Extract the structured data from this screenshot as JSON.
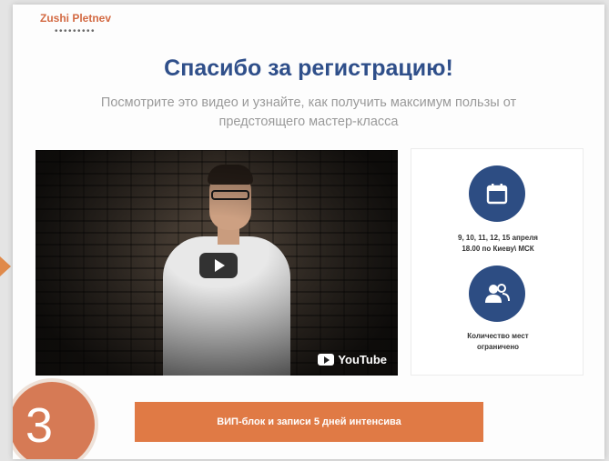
{
  "header": {
    "logo_text": "Zushi Pletnev",
    "logo_dots": "•••••••••"
  },
  "hero": {
    "title": "Спасибо за регистрацию!",
    "subtitle_line1": "Посмотрите это видео и узнайте, как получить максимум пользы от",
    "subtitle_line2": "предстоящего мастер-класса"
  },
  "video": {
    "play_icon": "play-icon",
    "badge_icon": "youtube-icon",
    "badge_text": "YouTube"
  },
  "info_card": {
    "items": [
      {
        "icon": "calendar-icon",
        "text_line1": "9, 10, 11, 12, 15 апреля",
        "text_line2": "18.00 по Киеву\\ МСК"
      },
      {
        "icon": "users-icon",
        "text_line1": "Количество мест",
        "text_line2": "ограничено"
      }
    ]
  },
  "cta": {
    "label": "ВИП-блок и записи 5 дней интенсива"
  },
  "step": {
    "number": "3"
  },
  "colors": {
    "title": "#2f4f8a",
    "icon_bg": "#2d4d83",
    "cta": "#e07a45",
    "logo": "#d36a43",
    "step": "#d67a55"
  }
}
